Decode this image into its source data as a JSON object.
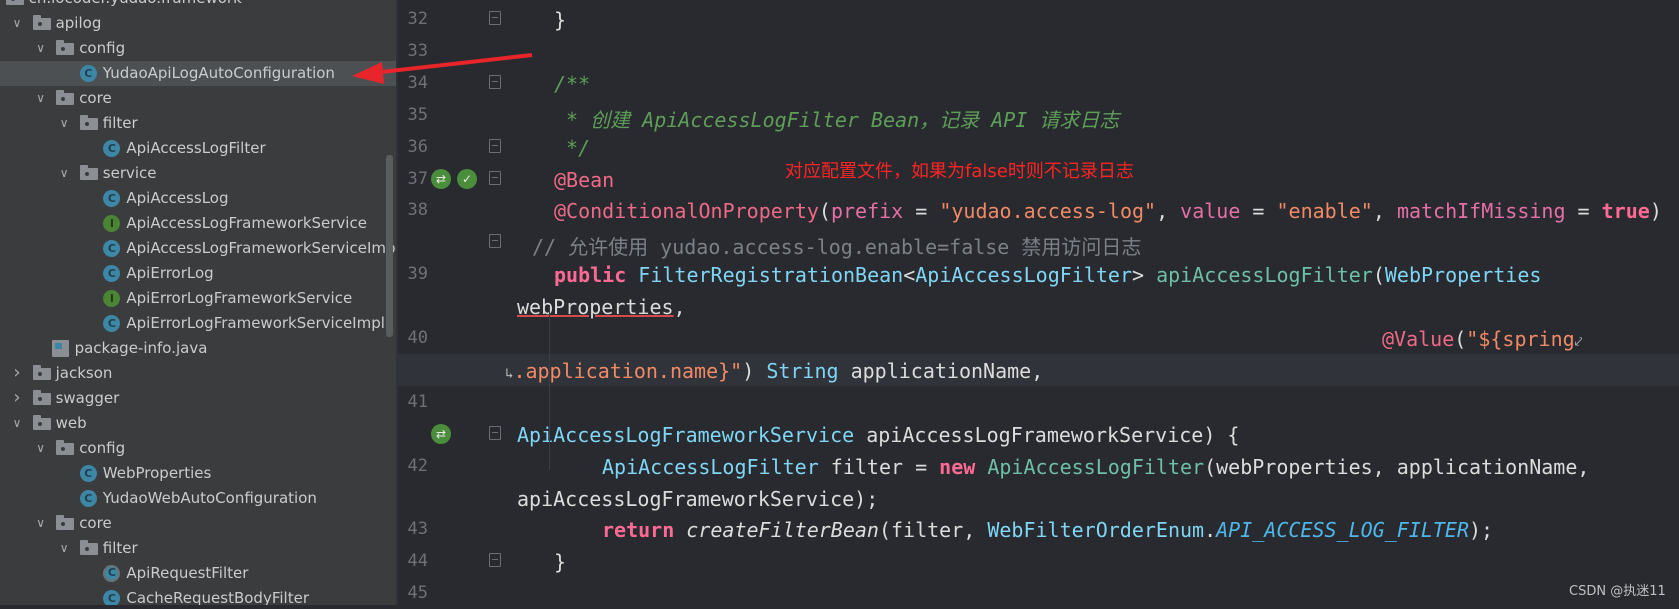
{
  "project_tree": {
    "items": [
      {
        "label": "cn.iocoder.yudao.framework",
        "depth": 0,
        "icon": "folder-icon",
        "state": "none"
      },
      {
        "label": "apilog",
        "depth": 1,
        "icon": "folder-icon",
        "state": "expanded"
      },
      {
        "label": "config",
        "depth": 2,
        "icon": "folder-icon",
        "state": "expanded"
      },
      {
        "label": "YudaoApiLogAutoConfiguration",
        "depth": 3,
        "icon": "class-icon",
        "state": "leaf",
        "selected": true
      },
      {
        "label": "core",
        "depth": 2,
        "icon": "folder-icon",
        "state": "expanded"
      },
      {
        "label": "filter",
        "depth": 3,
        "icon": "folder-icon",
        "state": "expanded"
      },
      {
        "label": "ApiAccessLogFilter",
        "depth": 4,
        "icon": "class-icon",
        "state": "leaf"
      },
      {
        "label": "service",
        "depth": 3,
        "icon": "folder-icon",
        "state": "expanded"
      },
      {
        "label": "ApiAccessLog",
        "depth": 4,
        "icon": "class-icon",
        "state": "leaf"
      },
      {
        "label": "ApiAccessLogFrameworkService",
        "depth": 4,
        "icon": "interface-icon",
        "state": "leaf"
      },
      {
        "label": "ApiAccessLogFrameworkServiceImpl",
        "depth": 4,
        "icon": "class-icon",
        "state": "leaf"
      },
      {
        "label": "ApiErrorLog",
        "depth": 4,
        "icon": "class-icon",
        "state": "leaf"
      },
      {
        "label": "ApiErrorLogFrameworkService",
        "depth": 4,
        "icon": "interface-icon",
        "state": "leaf"
      },
      {
        "label": "ApiErrorLogFrameworkServiceImpl",
        "depth": 4,
        "icon": "class-icon",
        "state": "leaf"
      },
      {
        "label": "package-info.java",
        "depth": 2,
        "icon": "package-info-icon",
        "state": "leaf"
      },
      {
        "label": "jackson",
        "depth": 1,
        "icon": "folder-icon",
        "state": "collapsed"
      },
      {
        "label": "swagger",
        "depth": 1,
        "icon": "folder-icon",
        "state": "collapsed"
      },
      {
        "label": "web",
        "depth": 1,
        "icon": "folder-icon",
        "state": "expanded"
      },
      {
        "label": "config",
        "depth": 2,
        "icon": "folder-icon",
        "state": "expanded"
      },
      {
        "label": "WebProperties",
        "depth": 3,
        "icon": "class-icon",
        "state": "leaf"
      },
      {
        "label": "YudaoWebAutoConfiguration",
        "depth": 3,
        "icon": "class-icon",
        "state": "leaf"
      },
      {
        "label": "core",
        "depth": 2,
        "icon": "folder-icon",
        "state": "expanded"
      },
      {
        "label": "filter",
        "depth": 3,
        "icon": "folder-icon",
        "state": "expanded"
      },
      {
        "label": "ApiRequestFilter",
        "depth": 4,
        "icon": "abstract-class-icon",
        "state": "leaf"
      },
      {
        "label": "CacheRequestBodyFilter",
        "depth": 4,
        "icon": "class-icon",
        "state": "leaf"
      }
    ]
  },
  "editor": {
    "rows": [
      {
        "num": "32",
        "tokens": [
          {
            "t": "}",
            "k": "p"
          }
        ]
      },
      {
        "num": "33",
        "tokens": []
      },
      {
        "num": "34",
        "tokens": [
          {
            "t": "/**",
            "k": "doc"
          }
        ]
      },
      {
        "num": "35",
        "tokens": [
          {
            "t": " * 创建 ApiAccessLogFilter Bean，记录 API 请求日志",
            "k": "doc"
          }
        ]
      },
      {
        "num": "36",
        "tokens": [
          {
            "t": " */",
            "k": "doc"
          }
        ]
      },
      {
        "num": "37",
        "tokens": [
          {
            "t": "@Bean",
            "k": "ann"
          }
        ]
      },
      {
        "num": "38",
        "tokens": [
          {
            "t": "@ConditionalOnProperty",
            "k": "ann"
          },
          {
            "t": "(",
            "k": "p"
          },
          {
            "t": "prefix",
            "k": "param"
          },
          {
            "t": " = ",
            "k": "p"
          },
          {
            "t": "\"yudao.access-log\"",
            "k": "str"
          },
          {
            "t": ", ",
            "k": "p"
          },
          {
            "t": "value",
            "k": "param"
          },
          {
            "t": " = ",
            "k": "p"
          },
          {
            "t": "\"enable\"",
            "k": "str"
          },
          {
            "t": ", ",
            "k": "p"
          },
          {
            "t": "matchIfMissing",
            "k": "param"
          },
          {
            "t": " = ",
            "k": "p"
          },
          {
            "t": "true",
            "k": "kw"
          },
          {
            "t": ")",
            "k": "p"
          }
        ]
      },
      {
        "num": "",
        "tokens": [
          {
            "t": "// 允许使用 yudao.access-log.enable=false 禁用访问日志",
            "k": "cm"
          }
        ]
      },
      {
        "num": "39",
        "tokens": [
          {
            "t": "public",
            "k": "kw"
          },
          {
            "t": " ",
            "k": "p"
          },
          {
            "t": "FilterRegistrationBean",
            "k": "type"
          },
          {
            "t": "<",
            "k": "p"
          },
          {
            "t": "ApiAccessLogFilter",
            "k": "type"
          },
          {
            "t": "> ",
            "k": "p"
          },
          {
            "t": "apiAccessLogFilter",
            "k": "fn"
          },
          {
            "t": "(",
            "k": "p"
          },
          {
            "t": "WebProperties",
            "k": "type"
          }
        ]
      },
      {
        "num": "",
        "tokens": [
          {
            "t": "webProperties",
            "k": "err"
          },
          {
            "t": ",",
            "k": "p"
          }
        ]
      },
      {
        "num": "40",
        "tokens": [
          {
            "t": "@Value",
            "k": "ann"
          },
          {
            "t": "(",
            "k": "p"
          },
          {
            "t": "\"${spring",
            "k": "str"
          },
          {
            "t": "⤦",
            "k": "wrap"
          }
        ]
      },
      {
        "num": "",
        "current": true,
        "tokens": [
          {
            "t": "↳",
            "k": "wrap"
          },
          {
            "t": ".application.name}\"",
            "k": "str"
          },
          {
            "t": ") ",
            "k": "p"
          },
          {
            "t": "String",
            "k": "type"
          },
          {
            "t": " applicationName,",
            "k": "p"
          }
        ]
      },
      {
        "num": "41",
        "tokens": []
      },
      {
        "num": "",
        "tokens": [
          {
            "t": "ApiAccessLogFrameworkService",
            "k": "type"
          },
          {
            "t": " apiAccessLogFrameworkService) {",
            "k": "p"
          }
        ]
      },
      {
        "num": "42",
        "tokens": [
          {
            "t": "ApiAccessLogFilter",
            "k": "type"
          },
          {
            "t": " filter = ",
            "k": "p"
          },
          {
            "t": "new",
            "k": "kw"
          },
          {
            "t": " ",
            "k": "p"
          },
          {
            "t": "ApiAccessLogFilter",
            "k": "fn"
          },
          {
            "t": "(webProperties, applicationName,",
            "k": "p"
          }
        ]
      },
      {
        "num": "",
        "tokens": [
          {
            "t": "apiAccessLogFrameworkService);",
            "k": "p"
          }
        ]
      },
      {
        "num": "43",
        "tokens": [
          {
            "t": "return",
            "k": "kw"
          },
          {
            "t": " ",
            "k": "p"
          },
          {
            "t": "createFilterBean",
            "k": "it"
          },
          {
            "t": "(filter, ",
            "k": "p"
          },
          {
            "t": "WebFilterOrderEnum",
            "k": "type"
          },
          {
            "t": ".",
            "k": "p"
          },
          {
            "t": "API_ACCESS_LOG_FILTER",
            "k": "const"
          },
          {
            "t": ");",
            "k": "p"
          }
        ]
      },
      {
        "num": "44",
        "tokens": [
          {
            "t": "}",
            "k": "p"
          }
        ]
      },
      {
        "num": "45",
        "tokens": []
      }
    ]
  },
  "annotation": {
    "note": "对应配置文件，如果为false时则不记录日志",
    "arrow_color": "#e8252a"
  },
  "watermark": "CSDN @执迷11"
}
